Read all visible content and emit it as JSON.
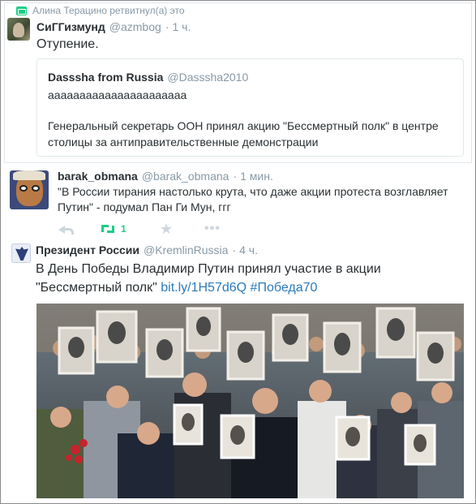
{
  "retweet_note": "Алина Терацино ретвитнул(а) это",
  "tweet1": {
    "name": "СиГГизмунд",
    "handle": "@azmbog",
    "time": "1 ч.",
    "text": "Отупение.",
    "quoted": {
      "name": "Dasssha from Russia",
      "handle": "@Dasssha2010",
      "line1": "аааааааааааааааааааааа",
      "line2": "Генеральный секретарь ООН принял акцию \"Бессмертный полк\" в центре столицы за антиправительственные демонстрации"
    }
  },
  "tweet2": {
    "name": "barak_obmana",
    "handle": "@barak_obmana",
    "time": "1 мин.",
    "text": "\"В России тирания настолько крута, что даже акции протеста возглавляет Путин\" - подумал Пан Ги Мун, ггг",
    "retweet_count": "1",
    "icons": [
      "reply-icon",
      "retweet-icon",
      "star-icon",
      "more-icon"
    ],
    "accent_color": "#19cf86"
  },
  "tweet3": {
    "name": "Президент России",
    "handle": "@KremlinRussia",
    "time": "4 ч.",
    "text_before": "В День Победы Владимир Путин принял участие в акции \"Бессмертный полк\" ",
    "link1": "bit.ly/1H57d6Q",
    "link2": "#Победа70",
    "link_color": "#2b7bb9"
  },
  "separator": "·"
}
